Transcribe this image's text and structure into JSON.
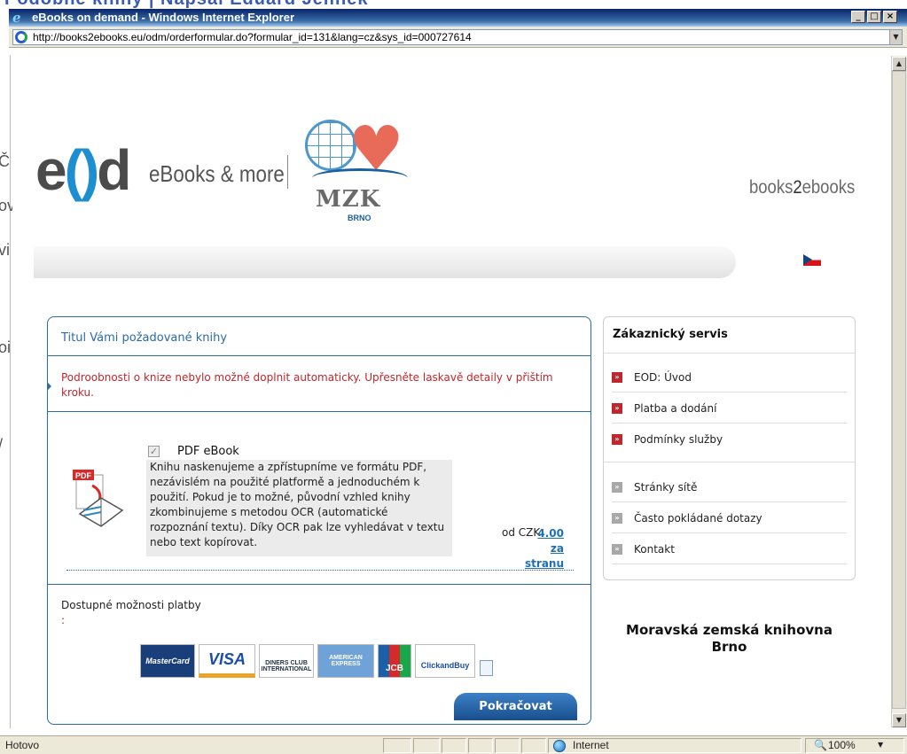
{
  "background": {
    "banner_text": "Podobné knihy | Napsal Eduard Jelínek",
    "partial_letters": [
      "Č",
      "ov",
      "vi",
      "oi",
      "/"
    ]
  },
  "window": {
    "title": "eBooks on demand - Windows Internet Explorer",
    "icon": "ie-logo-icon",
    "controls": {
      "minimize": "_",
      "maximize": "□",
      "close": "×"
    }
  },
  "address_bar": {
    "url": "http://books2ebooks.eu/odm/orderformular.do?formular_id=131&lang=cz&sys_id=000727614",
    "dropdown": "▼"
  },
  "header": {
    "logo_e": "e",
    "logo_o": "()",
    "logo_d": "d",
    "logo_tagline": "eBooks & more",
    "partner_name": "MZK",
    "partner_city": "BRNO",
    "brand_prefix": "books",
    "brand_2": "2",
    "brand_suffix": "ebooks",
    "language_flag": "czech-flag-icon"
  },
  "main": {
    "title": "Titul Vámi požadované knihy",
    "warning": "Podroobnosti o knize nebylo možné doplnit automaticky. Upřesněte laskavě detaily v přištím kroku.",
    "option": {
      "checked": "✓",
      "title": "PDF eBook",
      "description": "Knihu naskenujeme a zpřístupníme ve formátu PDF, nezávislém na použité platformě a jednoduchém k použití. Pokud je to možné, původní vzhled knihy zkombinujeme s metodou OCR (automatické rozpoznání textu). Díky OCR pak lze vyhledávat v textu nebo text kopírovat.",
      "price_prefix": "od CZK",
      "price_line1": "4.00 za",
      "price_line2": "stranu"
    },
    "payment": {
      "label": "Dostupné možnosti platby",
      "colon": ":",
      "cards": [
        "MasterCard",
        "VISA",
        "DINERS CLUB INTERNATIONAL",
        "AMERICAN EXPRESS",
        "JCB",
        "ClickandBuy"
      ]
    },
    "continue_button": "Pokračovat"
  },
  "sidebar": {
    "title": "Zákaznický servis",
    "primary_items": [
      {
        "label": "EOD: Úvod"
      },
      {
        "label": "Platba a dodání"
      },
      {
        "label": "Podmínky služby"
      }
    ],
    "secondary_items": [
      {
        "label": "Stránky sítě"
      },
      {
        "label": "Často pokládané dotazy"
      },
      {
        "label": "Kontakt"
      }
    ],
    "bullet": "»",
    "library_line1": "Moravská zemská knihovna",
    "library_line2": "Brno"
  },
  "status_bar": {
    "text": "Hotovo",
    "zone": "Internet",
    "zoom": "100%",
    "zoom_arrow": "▼"
  },
  "colors": {
    "accent": "#2a6ba8",
    "warning": "#c0262d",
    "button": "#1f5a9c",
    "bullet_primary": "#c0262d",
    "bullet_secondary": "#a8a8a8"
  }
}
